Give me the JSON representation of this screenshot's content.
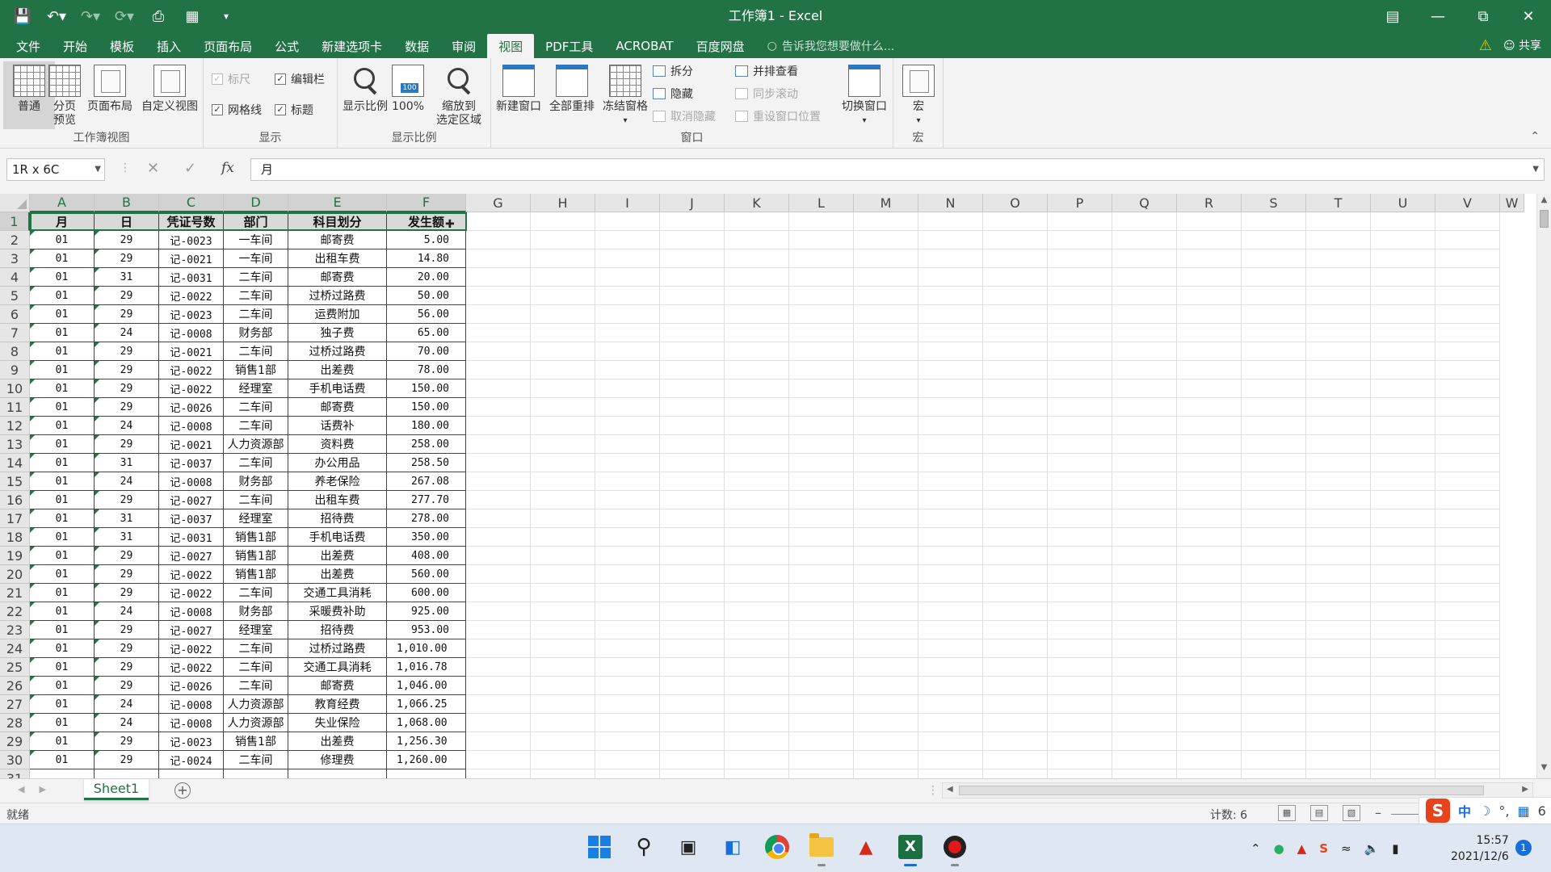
{
  "window": {
    "title": "工作簿1 - Excel",
    "accent": "#217346"
  },
  "qat": {
    "icons": [
      "save-icon",
      "undo-icon",
      "redo-icon",
      "repeat-icon",
      "print-preview-icon",
      "page-setup-icon",
      "customize-qat-icon"
    ]
  },
  "tabs": [
    {
      "label": "文件"
    },
    {
      "label": "开始"
    },
    {
      "label": "模板"
    },
    {
      "label": "插入"
    },
    {
      "label": "页面布局"
    },
    {
      "label": "公式"
    },
    {
      "label": "新建选项卡"
    },
    {
      "label": "数据"
    },
    {
      "label": "审阅"
    },
    {
      "label": "视图"
    },
    {
      "label": "PDF工具"
    },
    {
      "label": "ACROBAT"
    },
    {
      "label": "百度网盘"
    }
  ],
  "active_tab": "视图",
  "tellme": "告诉我您想要做什么...",
  "share": "共享",
  "ribbon": {
    "workbook_views": {
      "label": "工作簿视图",
      "normal": "普通",
      "page_break_line1": "分页",
      "page_break_line2": "预览",
      "page_layout": "页面布局",
      "custom_views": "自定义视图"
    },
    "show": {
      "label": "显示",
      "ruler": "标尺",
      "formula_bar": "编辑栏",
      "gridlines": "网格线",
      "headings": "标题"
    },
    "zoom": {
      "label": "显示比例",
      "zoom": "显示比例",
      "hundred": "100%",
      "zoom_sel_line1": "缩放到",
      "zoom_sel_line2": "选定区域"
    },
    "window": {
      "label": "窗口",
      "new_window": "新建窗口",
      "arrange_all": "全部重排",
      "freeze": "冻结窗格",
      "split": "拆分",
      "hide": "隐藏",
      "unhide": "取消隐藏",
      "side_by_side": "并排查看",
      "sync_scroll": "同步滚动",
      "reset_pos": "重设窗口位置",
      "switch": "切换窗口"
    },
    "macros": {
      "label": "宏",
      "macro": "宏"
    }
  },
  "formula_bar": {
    "name_box": "1R x 6C",
    "fx": "fx",
    "value": "月"
  },
  "sheet": {
    "columns": [
      "A",
      "B",
      "C",
      "D",
      "E",
      "F",
      "G",
      "H",
      "I",
      "J",
      "K",
      "L",
      "M",
      "N",
      "O",
      "P",
      "Q",
      "R",
      "S",
      "T",
      "U",
      "V"
    ],
    "visible_partial_col": "W",
    "header": [
      "月",
      "日",
      "凭证号数",
      "部门",
      "科目划分",
      "发生额"
    ],
    "rows": [
      [
        "01",
        "29",
        "记-0023",
        "一车间",
        "邮寄费",
        "5.00"
      ],
      [
        "01",
        "29",
        "记-0021",
        "一车间",
        "出租车费",
        "14.80"
      ],
      [
        "01",
        "31",
        "记-0031",
        "二车间",
        "邮寄费",
        "20.00"
      ],
      [
        "01",
        "29",
        "记-0022",
        "二车间",
        "过桥过路费",
        "50.00"
      ],
      [
        "01",
        "29",
        "记-0023",
        "二车间",
        "运费附加",
        "56.00"
      ],
      [
        "01",
        "24",
        "记-0008",
        "财务部",
        "独子费",
        "65.00"
      ],
      [
        "01",
        "29",
        "记-0021",
        "二车间",
        "过桥过路费",
        "70.00"
      ],
      [
        "01",
        "29",
        "记-0022",
        "销售1部",
        "出差费",
        "78.00"
      ],
      [
        "01",
        "29",
        "记-0022",
        "经理室",
        "手机电话费",
        "150.00"
      ],
      [
        "01",
        "29",
        "记-0026",
        "二车间",
        "邮寄费",
        "150.00"
      ],
      [
        "01",
        "24",
        "记-0008",
        "二车间",
        "话费补",
        "180.00"
      ],
      [
        "01",
        "29",
        "记-0021",
        "人力资源部",
        "资料费",
        "258.00"
      ],
      [
        "01",
        "31",
        "记-0037",
        "二车间",
        "办公用品",
        "258.50"
      ],
      [
        "01",
        "24",
        "记-0008",
        "财务部",
        "养老保险",
        "267.08"
      ],
      [
        "01",
        "29",
        "记-0027",
        "二车间",
        "出租车费",
        "277.70"
      ],
      [
        "01",
        "31",
        "记-0037",
        "经理室",
        "招待费",
        "278.00"
      ],
      [
        "01",
        "31",
        "记-0031",
        "销售1部",
        "手机电话费",
        "350.00"
      ],
      [
        "01",
        "29",
        "记-0027",
        "销售1部",
        "出差费",
        "408.00"
      ],
      [
        "01",
        "29",
        "记-0022",
        "销售1部",
        "出差费",
        "560.00"
      ],
      [
        "01",
        "29",
        "记-0022",
        "二车间",
        "交通工具消耗",
        "600.00"
      ],
      [
        "01",
        "24",
        "记-0008",
        "财务部",
        "采暖费补助",
        "925.00"
      ],
      [
        "01",
        "29",
        "记-0027",
        "经理室",
        "招待费",
        "953.00"
      ],
      [
        "01",
        "29",
        "记-0022",
        "二车间",
        "过桥过路费",
        "1,010.00"
      ],
      [
        "01",
        "29",
        "记-0022",
        "二车间",
        "交通工具消耗",
        "1,016.78"
      ],
      [
        "01",
        "29",
        "记-0026",
        "二车间",
        "邮寄费",
        "1,046.00"
      ],
      [
        "01",
        "24",
        "记-0008",
        "人力资源部",
        "教育经费",
        "1,066.25"
      ],
      [
        "01",
        "24",
        "记-0008",
        "人力资源部",
        "失业保险",
        "1,068.00"
      ],
      [
        "01",
        "29",
        "记-0023",
        "销售1部",
        "出差费",
        "1,256.30"
      ],
      [
        "01",
        "29",
        "记-0024",
        "二车间",
        "修理费",
        "1,260.00"
      ]
    ],
    "partial_row_number": "31",
    "sheet_tab": "Sheet1"
  },
  "status": {
    "ready": "就绪",
    "count": "计数: 6",
    "ime_zh": "中",
    "ime_punct": "°,",
    "ime_trailing": "6"
  },
  "taskbar": {
    "time": "15:57",
    "date": "2021/12/6",
    "notifications": "1"
  }
}
